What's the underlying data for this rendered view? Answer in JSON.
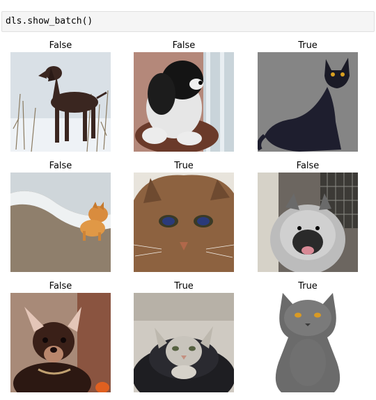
{
  "notebook": {
    "code_cell": {
      "source": "dls.show_batch()"
    }
  },
  "output": {
    "grid": [
      {
        "label": "False",
        "subject": "brown dog standing in snowy grass"
      },
      {
        "label": "False",
        "subject": "black and white dog looking out window"
      },
      {
        "label": "True",
        "subject": "black cat on grey background"
      },
      {
        "label": "False",
        "subject": "small orange dog on beach by the waves"
      },
      {
        "label": "True",
        "subject": "close-up of tabby cat face"
      },
      {
        "label": "False",
        "subject": "fluffy grey dog in doorway"
      },
      {
        "label": "False",
        "subject": "small brown chihuahua"
      },
      {
        "label": "True",
        "subject": "tabby kitten in dark bed"
      },
      {
        "label": "True",
        "subject": "grey cat on white background"
      }
    ]
  },
  "colors": {
    "cell_background": "#f5f5f5",
    "cell_border": "#e0e0e0"
  }
}
